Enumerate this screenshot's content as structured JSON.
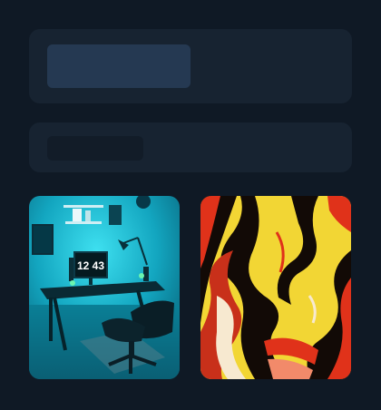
{
  "colors": {
    "background": "#0f1925",
    "panel": "#172331",
    "skeleton_accent": "#253952",
    "skeleton_dark": "#121c28",
    "cyan": "#19b8d0",
    "fluid_yellow": "#f2d634",
    "fluid_red": "#e0321a",
    "fluid_black": "#120a06"
  },
  "gallery": {
    "images": [
      {
        "name": "desk-setup-image",
        "clock_text": "12 43"
      },
      {
        "name": "abstract-fluid-image"
      }
    ]
  }
}
